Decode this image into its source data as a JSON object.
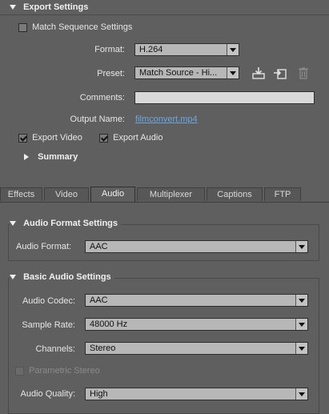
{
  "export_settings": {
    "title": "Export Settings",
    "match_sequence_label": "Match Sequence Settings",
    "format_label": "Format:",
    "format_value": "H.264",
    "preset_label": "Preset:",
    "preset_value": "Match Source - Hi...",
    "comments_label": "Comments:",
    "comments_value": "",
    "output_name_label": "Output Name:",
    "output_name_value": "filmconvert.mp4",
    "export_video_label": "Export Video",
    "export_audio_label": "Export Audio",
    "summary_label": "Summary",
    "match_sequence_checked": false,
    "export_video_checked": true,
    "export_audio_checked": true,
    "icons": [
      "save-preset-icon",
      "import-preset-icon",
      "delete-preset-icon"
    ]
  },
  "tabs": [
    "Effects",
    "Video",
    "Audio",
    "Multiplexer",
    "Captions",
    "FTP"
  ],
  "active_tab": "Audio",
  "audio_format_settings": {
    "title": "Audio Format Settings",
    "audio_format_label": "Audio Format:",
    "audio_format_value": "AAC"
  },
  "basic_audio_settings": {
    "title": "Basic Audio Settings",
    "codec_label": "Audio Codec:",
    "codec_value": "AAC",
    "sample_rate_label": "Sample Rate:",
    "sample_rate_value": "48000 Hz",
    "channels_label": "Channels:",
    "channels_value": "Stereo",
    "parametric_stereo_label": "Parametric Stereo",
    "parametric_stereo_checked": false,
    "quality_label": "Audio Quality:",
    "quality_value": "High"
  },
  "colors": {
    "background": "#5f5f5f",
    "dropdown": "#b7b7b7",
    "link": "#6ea6e0"
  }
}
